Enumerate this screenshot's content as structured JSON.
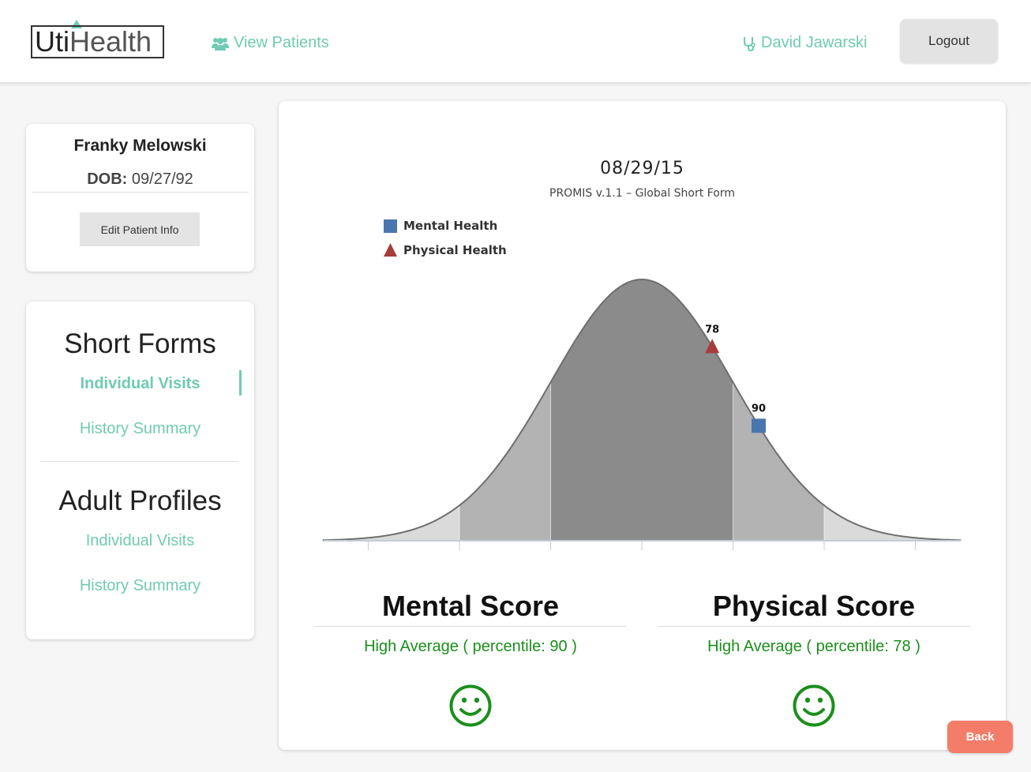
{
  "header": {
    "logo_bold": "Uti",
    "logo_light": "Health",
    "nav_patients_label": "View Patients",
    "nav_patients_icon": "users-icon",
    "user_name": "David Jawarski",
    "user_icon": "stethoscope-icon",
    "logout_label": "Logout",
    "accent_color": "#6fcbb3"
  },
  "patient": {
    "name": "Franky Melowski",
    "dob_label": "DOB:",
    "dob_value": "09/27/92",
    "edit_label": "Edit Patient Info"
  },
  "sidebar": {
    "short_forms": {
      "title": "Short Forms",
      "items": [
        {
          "label": "Individual Visits",
          "active": true
        },
        {
          "label": "History Summary",
          "active": false
        }
      ]
    },
    "adult_profiles": {
      "title": "Adult Profiles",
      "items": [
        {
          "label": "Individual Visits",
          "active": false
        },
        {
          "label": "History Summary",
          "active": false
        }
      ]
    }
  },
  "chart": {
    "date": "08/29/15",
    "subtitle": "PROMIS v.1.1 – Global Short Form"
  },
  "chart_data": {
    "type": "scatter",
    "title": "08/29/15",
    "subtitle": "PROMIS v.1.1 – Global Short Form",
    "distribution": "normal",
    "x_unit": "percentile",
    "legend_position": "top-left",
    "series": [
      {
        "name": "Mental Health",
        "marker": "square",
        "color": "#4a76b0",
        "value": 90
      },
      {
        "name": "Physical Health",
        "marker": "triangle",
        "color": "#a83c3c",
        "value": 78
      }
    ]
  },
  "scores": {
    "mental": {
      "title": "Mental Score",
      "description": "High Average ( percentile: 90 )",
      "icon": "smiley-icon"
    },
    "physical": {
      "title": "Physical Score",
      "description": "High Average ( percentile: 78 )",
      "icon": "smiley-icon"
    },
    "status_color": "#1b8f1b"
  },
  "back_label": "Back"
}
